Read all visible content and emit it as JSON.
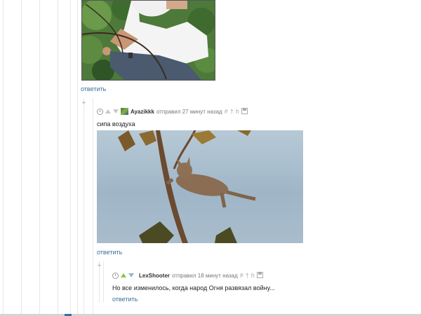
{
  "thread": {
    "top_reply_link": "ответить",
    "comments": [
      {
        "author": "Ayazikkk",
        "meta": "отправил 27 минут назад",
        "text": "сипа воздуха",
        "reply_label": "ответить",
        "tools": [
          "#",
          "†",
          "h",
          "save-icon"
        ]
      },
      {
        "author": "LexShooter",
        "meta": "отправил 18 минут назад",
        "text": "Но все изменилось, когда народ Огня развязал войну...",
        "reply_label": "ответить",
        "tools": [
          "#",
          "†",
          "h",
          "save-icon"
        ]
      }
    ]
  },
  "colors": {
    "link": "#3a6f9f",
    "vote_up_active": "#8cc63f",
    "vote_inactive": "#c8c8c8",
    "thread_line": "#e8e8e8"
  }
}
